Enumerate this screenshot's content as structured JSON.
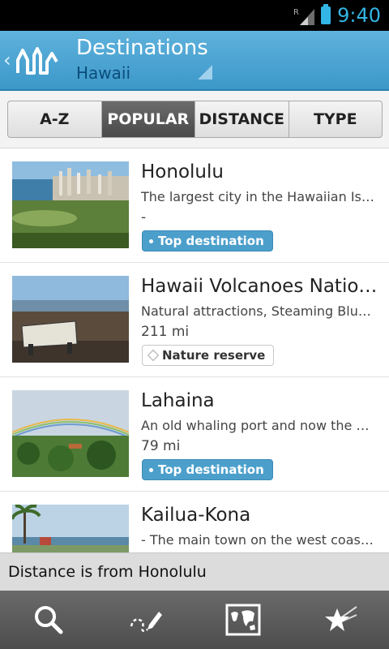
{
  "status_bar": {
    "time": "9:40",
    "signal_label": "R"
  },
  "action_bar": {
    "title": "Destinations",
    "subtitle": "Hawaii"
  },
  "tabs": [
    {
      "label": "A-Z",
      "active": false
    },
    {
      "label": "POPULAR",
      "active": true
    },
    {
      "label": "DISTANCE",
      "active": false
    },
    {
      "label": "TYPE",
      "active": false
    }
  ],
  "items": [
    {
      "title": "Honolulu",
      "description": "The largest city in the Hawaiian Isl...",
      "distance": "-",
      "badge": "Top destination",
      "badge_type": "top"
    },
    {
      "title": "Hawaii Volcanoes Nation...",
      "description": "Natural attractions, Steaming Bluff...",
      "distance": "211 mi",
      "badge": "Nature reserve",
      "badge_type": "nature"
    },
    {
      "title": "Lahaina",
      "description": "An old whaling port and now the m...",
      "distance": "79 mi",
      "badge": "Top destination",
      "badge_type": "top"
    },
    {
      "title": "Kailua-Kona",
      "description": "- The main town on the west coast,...",
      "distance": "",
      "badge": "",
      "badge_type": ""
    }
  ],
  "info_bar": {
    "text": "Distance is from Honolulu"
  },
  "toolbar": {
    "icons": [
      "search-icon",
      "edit-route-icon",
      "map-icon",
      "favorites-icon"
    ]
  },
  "colors": {
    "accent": "#33b5e5",
    "action_bar": "#4fa8d6",
    "badge_top": "#4c9fcb"
  }
}
